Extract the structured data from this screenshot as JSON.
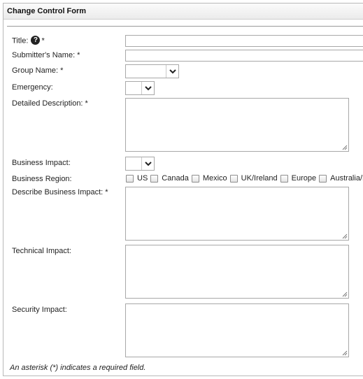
{
  "form": {
    "title": "Change Control Form",
    "footnote": "An asterisk (*) indicates a required field."
  },
  "fields": {
    "title": {
      "label": "Title:",
      "required_mark": "*",
      "help_icon": "question-circle-icon",
      "value": ""
    },
    "submitter": {
      "label": "Submitter's Name: *",
      "value": ""
    },
    "group": {
      "label": "Group Name: *",
      "value": ""
    },
    "emergency": {
      "label": "Emergency:",
      "value": ""
    },
    "detailed_description": {
      "label": "Detailed Description: *",
      "value": ""
    },
    "business_impact": {
      "label": "Business Impact:",
      "value": ""
    },
    "business_region": {
      "label": "Business Region:",
      "options": [
        "US",
        "Canada",
        "Mexico",
        "UK/Ireland",
        "Europe",
        "Australia/NZ"
      ]
    },
    "describe_business_impact": {
      "label": "Describe Business Impact: *",
      "value": ""
    },
    "technical_impact": {
      "label": "Technical Impact:",
      "value": ""
    },
    "security_impact": {
      "label": "Security Impact:",
      "value": ""
    }
  }
}
